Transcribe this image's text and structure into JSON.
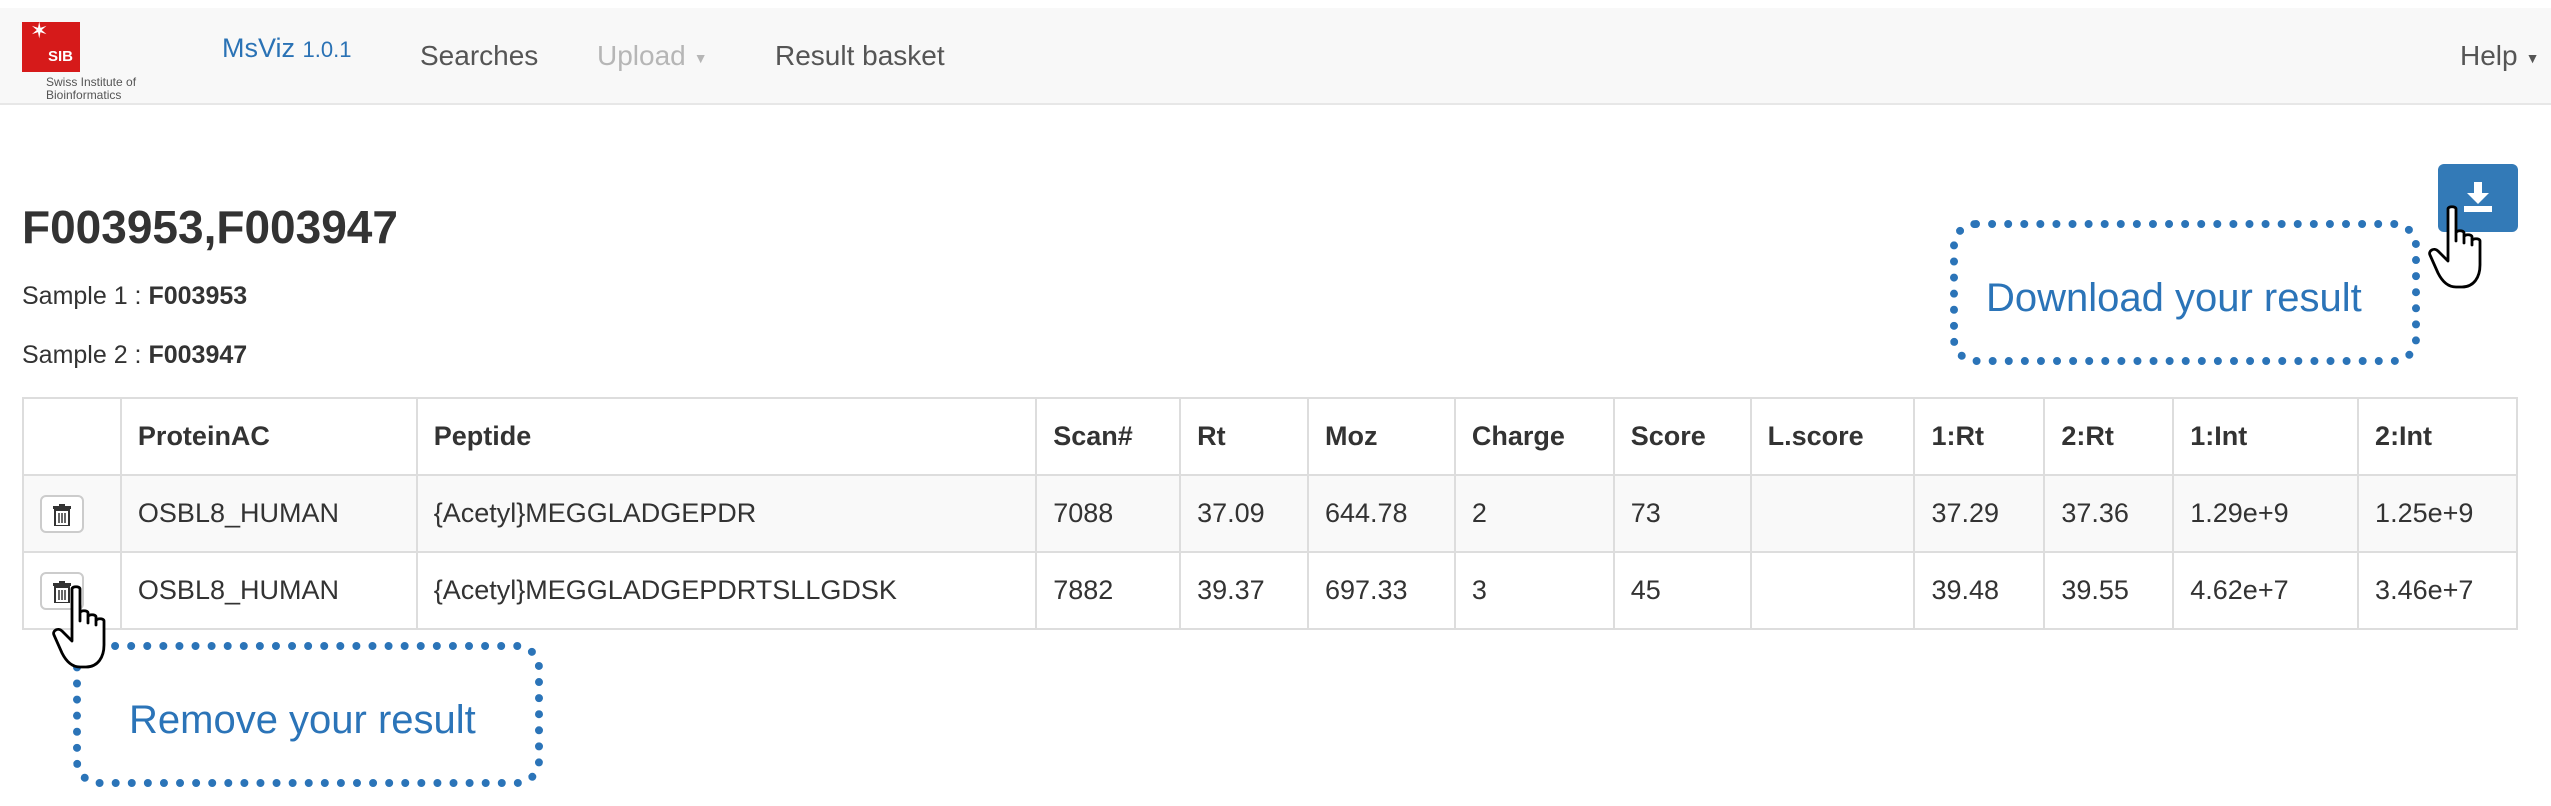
{
  "navbar": {
    "logo_sib": "SIB",
    "logo_text_1": "Swiss Institute of",
    "logo_text_2": "Bioinformatics",
    "brand": "MsViz",
    "version": "1.0.1",
    "searches": "Searches",
    "upload": "Upload",
    "result_basket": "Result basket",
    "help": "Help"
  },
  "page": {
    "title": "F003953,F003947",
    "sample1_label": "Sample 1 :",
    "sample1_value": "F003953",
    "sample2_label": "Sample 2 :",
    "sample2_value": "F003947"
  },
  "table": {
    "headers": [
      "",
      "ProteinAC",
      "Peptide",
      "Scan#",
      "Rt",
      "Moz",
      "Charge",
      "Score",
      "L.score",
      "1:Rt",
      "2:Rt",
      "1:Int",
      "2:Int"
    ],
    "rows": [
      {
        "protein": "OSBL8_HUMAN",
        "peptide": "{Acetyl}MEGGLADGEPDR",
        "scan": "7088",
        "rt": "37.09",
        "moz": "644.78",
        "charge": "2",
        "score": "73",
        "lscore": "",
        "rt1": "37.29",
        "rt2": "37.36",
        "int1": "1.29e+9",
        "int2": "1.25e+9"
      },
      {
        "protein": "OSBL8_HUMAN",
        "peptide": "{Acetyl}MEGGLADGEPDRTSLLGDSK",
        "scan": "7882",
        "rt": "39.37",
        "moz": "697.33",
        "charge": "3",
        "score": "45",
        "lscore": "",
        "rt1": "39.48",
        "rt2": "39.55",
        "int1": "4.62e+7",
        "int2": "3.46e+7"
      }
    ]
  },
  "annotations": {
    "download": "Download your result",
    "remove": "Remove your result"
  },
  "icons": {
    "trash": "trash-icon",
    "download": "download-icon",
    "pointer": "hand-pointer-icon",
    "dropdown": "caret-down-icon"
  },
  "colors": {
    "accent": "#337ab7",
    "annotation": "#2b74b8",
    "logo_red": "#d61a1a"
  }
}
